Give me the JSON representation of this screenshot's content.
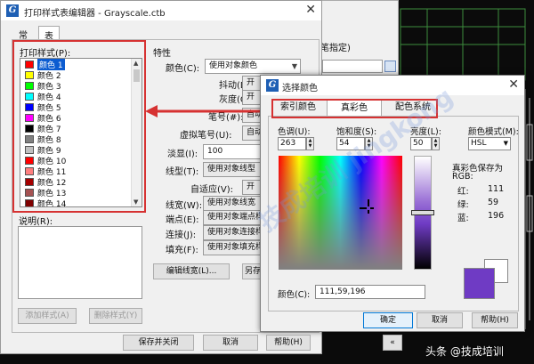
{
  "main_dialog": {
    "title": "打印样式表编辑器 - Grayscale.ctb",
    "tabs": [
      {
        "label": "常规"
      },
      {
        "label": "表格视图"
      }
    ],
    "print_styles_label": "打印样式(P):",
    "styles": [
      {
        "name": "颜色 1",
        "color": "#ff0000"
      },
      {
        "name": "颜色 2",
        "color": "#ffff00"
      },
      {
        "name": "颜色 3",
        "color": "#00ff00"
      },
      {
        "name": "颜色 4",
        "color": "#00ffff"
      },
      {
        "name": "颜色 5",
        "color": "#0000ff"
      },
      {
        "name": "颜色 6",
        "color": "#ff00ff"
      },
      {
        "name": "颜色 7",
        "color": "#000000"
      },
      {
        "name": "颜色 8",
        "color": "#808080"
      },
      {
        "name": "颜色 9",
        "color": "#c0c0c0"
      },
      {
        "name": "颜色 10",
        "color": "#ff0000"
      },
      {
        "name": "颜色 11",
        "color": "#ff7f7f"
      },
      {
        "name": "颜色 12",
        "color": "#a50000"
      },
      {
        "name": "颜色 13",
        "color": "#a55252"
      },
      {
        "name": "颜色 14",
        "color": "#7f0000"
      }
    ],
    "description_label": "说明(R):",
    "add_style_button": "添加样式(A)",
    "delete_style_button": "删除样式(Y)",
    "save_close_button": "保存并关闭",
    "cancel_button": "取消",
    "help_button": "帮助(H)",
    "properties": {
      "group_label": "特性",
      "color_label": "颜色(C):",
      "color_value": "使用对象颜色",
      "dither_label": "抖动(D):",
      "dither_value": "开",
      "grayscale_label": "灰度(G):",
      "grayscale_value": "开",
      "pen_label": "笔号(#):",
      "pen_value": "自动",
      "vpen_label": "虚拟笔号(U):",
      "vpen_value": "自动",
      "screening_label": "淡显(I):",
      "screening_value": "100",
      "linetype_label": "线型(T):",
      "linetype_value": "使用对象线型",
      "adaptive_label": "自适应(V):",
      "adaptive_value": "开",
      "lineweight_label": "线宽(W):",
      "lineweight_value": "使用对象线宽",
      "endstyle_label": "端点(E):",
      "endstyle_value": "使用对象端点样",
      "joinstyle_label": "连接(J):",
      "joinstyle_value": "使用对象连接样",
      "fillstyle_label": "填充(F):",
      "fillstyle_value": "使用对象填充样",
      "edit_lineweights_button": "编辑线宽(L)...",
      "saveas_button": "另存"
    }
  },
  "bg_window": {
    "label": "笔指定)"
  },
  "color_dialog": {
    "title": "选择颜色",
    "tabs": [
      {
        "label": "索引颜色",
        "active": false
      },
      {
        "label": "真彩色",
        "active": true
      },
      {
        "label": "配色系统",
        "active": false
      }
    ],
    "hue_label": "色调(U):",
    "hue_value": "263",
    "saturation_label": "饱和度(S):",
    "saturation_value": "54",
    "luminance_label": "亮度(L):",
    "luminance_value": "50",
    "color_model_label": "颜色模式(M):",
    "color_model_value": "HSL",
    "rgb_title_line1": "真彩色保存为",
    "rgb_title_line2": "RGB:",
    "red_label": "红:",
    "red_value": "111",
    "green_label": "绿:",
    "green_value": "59",
    "blue_label": "蓝:",
    "blue_value": "196",
    "color_label": "颜色(C):",
    "color_value": "111,59,196",
    "ok_button": "确定",
    "cancel_button": "取消",
    "help_button": "帮助(H)",
    "selected_color": "#6f3bc4"
  },
  "overlay": {
    "watermark": "技成培训 jingkong",
    "credit": "头条 @技成培训"
  },
  "colors": {
    "highlight_red": "#d63232",
    "selection_blue": "#0c5cd1"
  }
}
